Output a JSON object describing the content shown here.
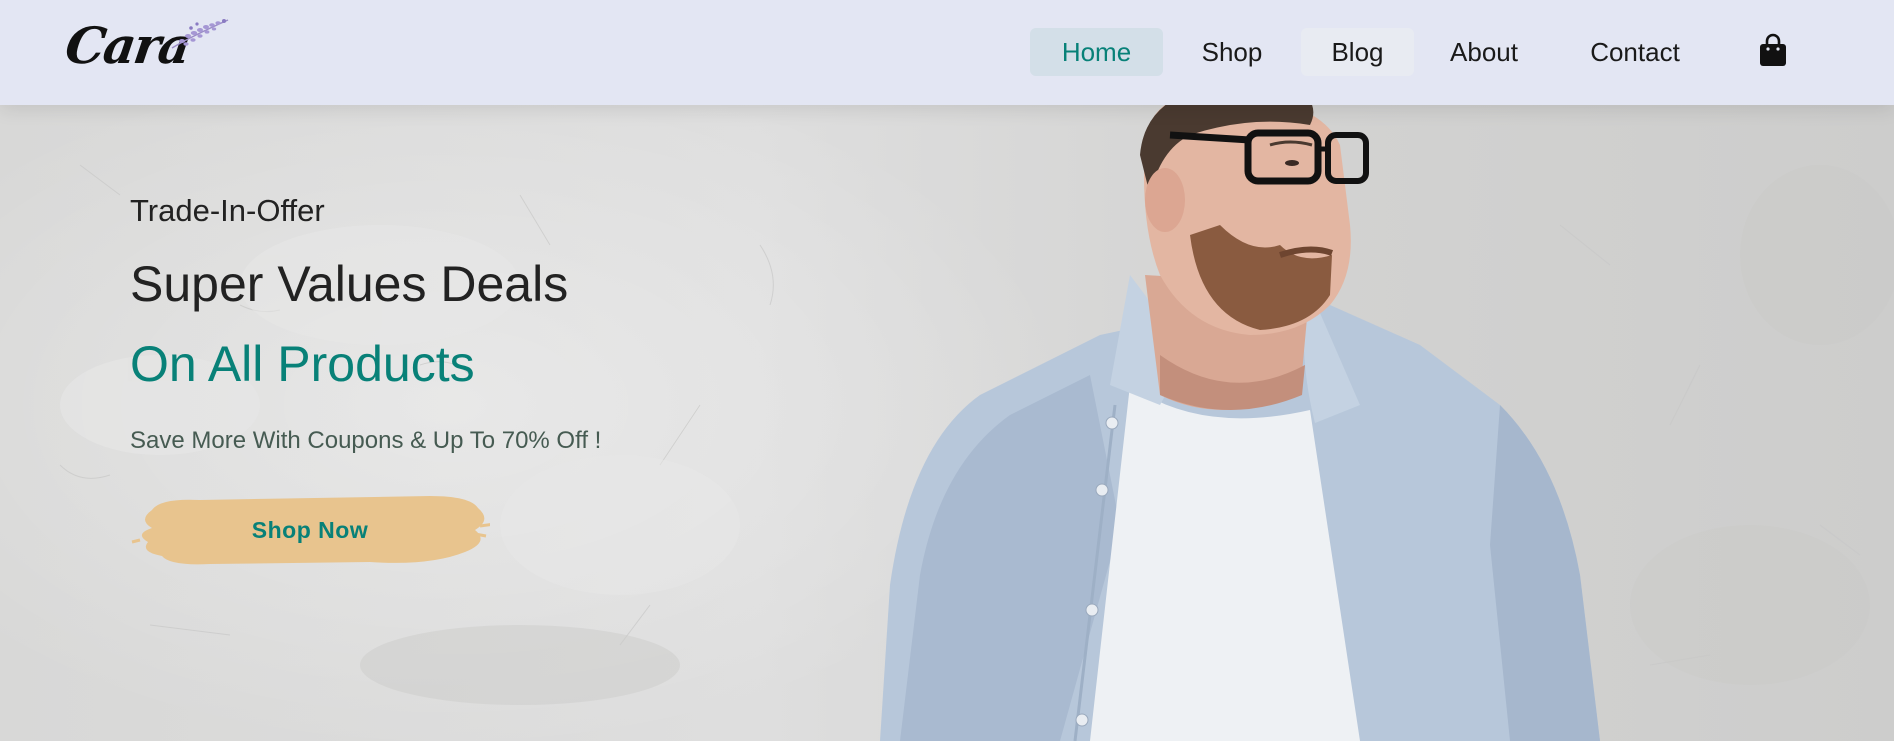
{
  "brand": {
    "logo_text": "Cara",
    "logo_icon": "lavender-sprig-icon"
  },
  "nav": {
    "items": [
      {
        "label": "Home",
        "active": true
      },
      {
        "label": "Shop",
        "active": false
      },
      {
        "label": "Blog",
        "active": false
      },
      {
        "label": "About",
        "active": false
      },
      {
        "label": "Contact",
        "active": false
      }
    ],
    "cart_icon": "shopping-bag-icon"
  },
  "hero": {
    "offer_label": "Trade-In-Offer",
    "headline_line1": "Super Values Deals",
    "headline_line2": "On All Products",
    "subtext": "Save More With Coupons & Up To 70% Off !",
    "cta_label": "Shop Now"
  },
  "colors": {
    "header_bg": "#e3e6f3",
    "accent": "#088178",
    "active_nav_bg": "#d3dfe8",
    "button_brush": "#e8c48e",
    "text_dark": "#222222"
  }
}
